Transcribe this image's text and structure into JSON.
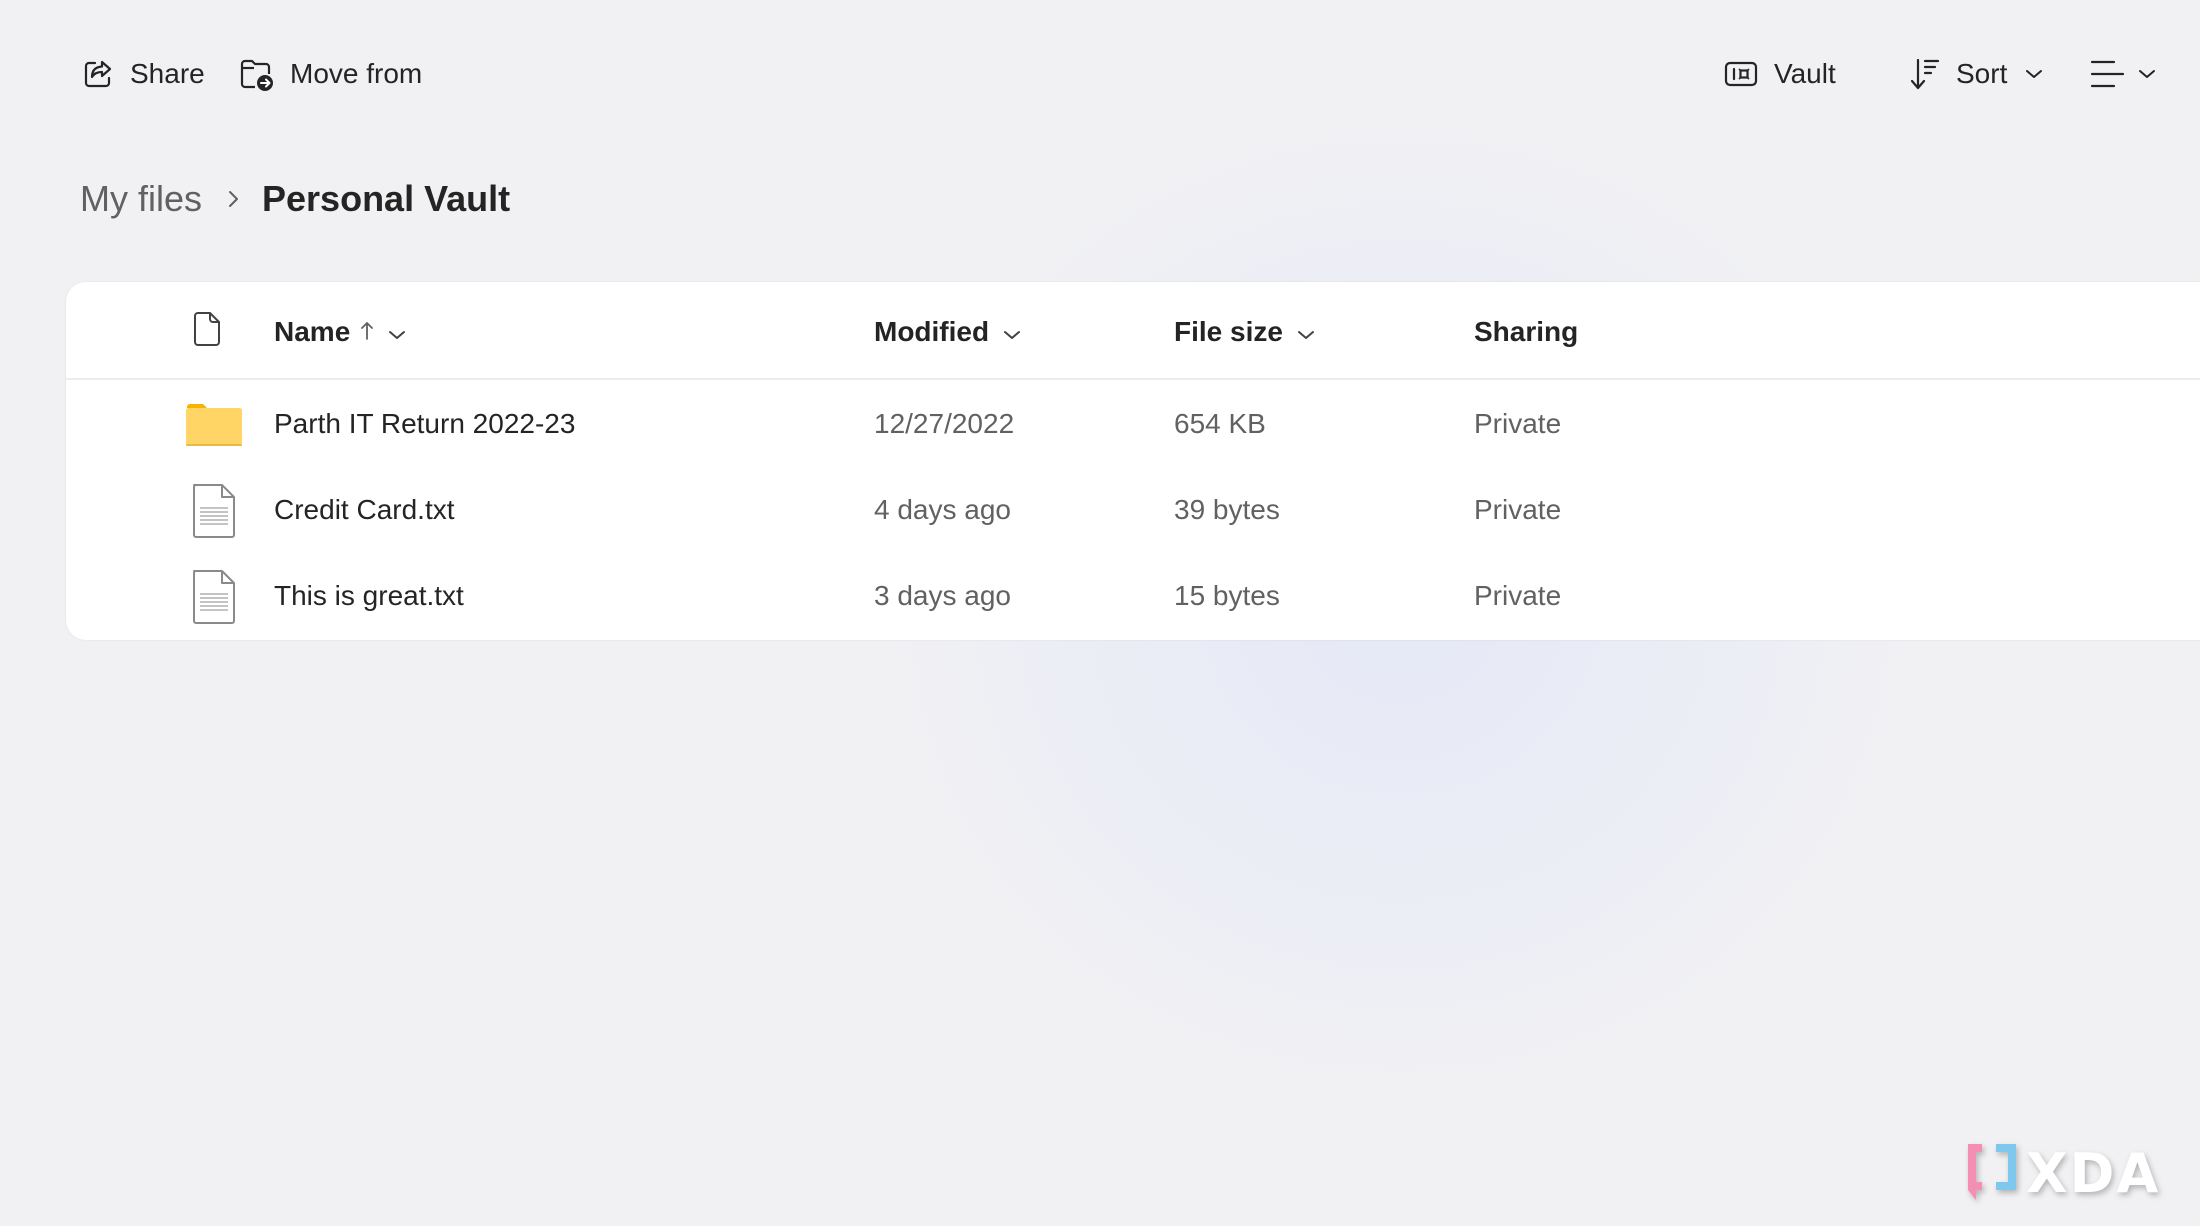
{
  "toolbar": {
    "share_label": "Share",
    "move_label": "Move from",
    "vault_label": "Vault",
    "sort_label": "Sort",
    "icons": {
      "share": "share-icon",
      "move": "folder-move-icon",
      "vault": "vault-icon",
      "sort": "sort-icon",
      "view": "list-view-icon"
    }
  },
  "breadcrumb": {
    "items": [
      "My files",
      "Personal Vault"
    ],
    "separator_icon": "chevron-right-icon"
  },
  "table": {
    "columns": [
      {
        "label": "",
        "icon": "file-type-icon"
      },
      {
        "label": "Name",
        "sort": "ascending"
      },
      {
        "label": "Modified"
      },
      {
        "label": "File size"
      },
      {
        "label": "Sharing"
      }
    ],
    "rows": [
      {
        "type": "folder",
        "name": "Parth IT Return 2022-23",
        "modified": "12/27/2022",
        "size": "654 KB",
        "sharing": "Private"
      },
      {
        "type": "txt",
        "name": "Credit Card.txt",
        "modified": "4 days ago",
        "size": "39 bytes",
        "sharing": "Private"
      },
      {
        "type": "txt",
        "name": "This is great.txt",
        "modified": "3 days ago",
        "size": "15 bytes",
        "sharing": "Private"
      }
    ]
  },
  "watermark": {
    "text": "XDA",
    "colors": {
      "pink": "#f48fb1",
      "blue": "#7ec8ee"
    }
  },
  "colors": {
    "background": "#f1f1f4",
    "card": "#ffffff",
    "text_primary": "#242424",
    "text_secondary": "#616161",
    "folder": "#ffd666",
    "folder_tab": "#f4b400"
  }
}
